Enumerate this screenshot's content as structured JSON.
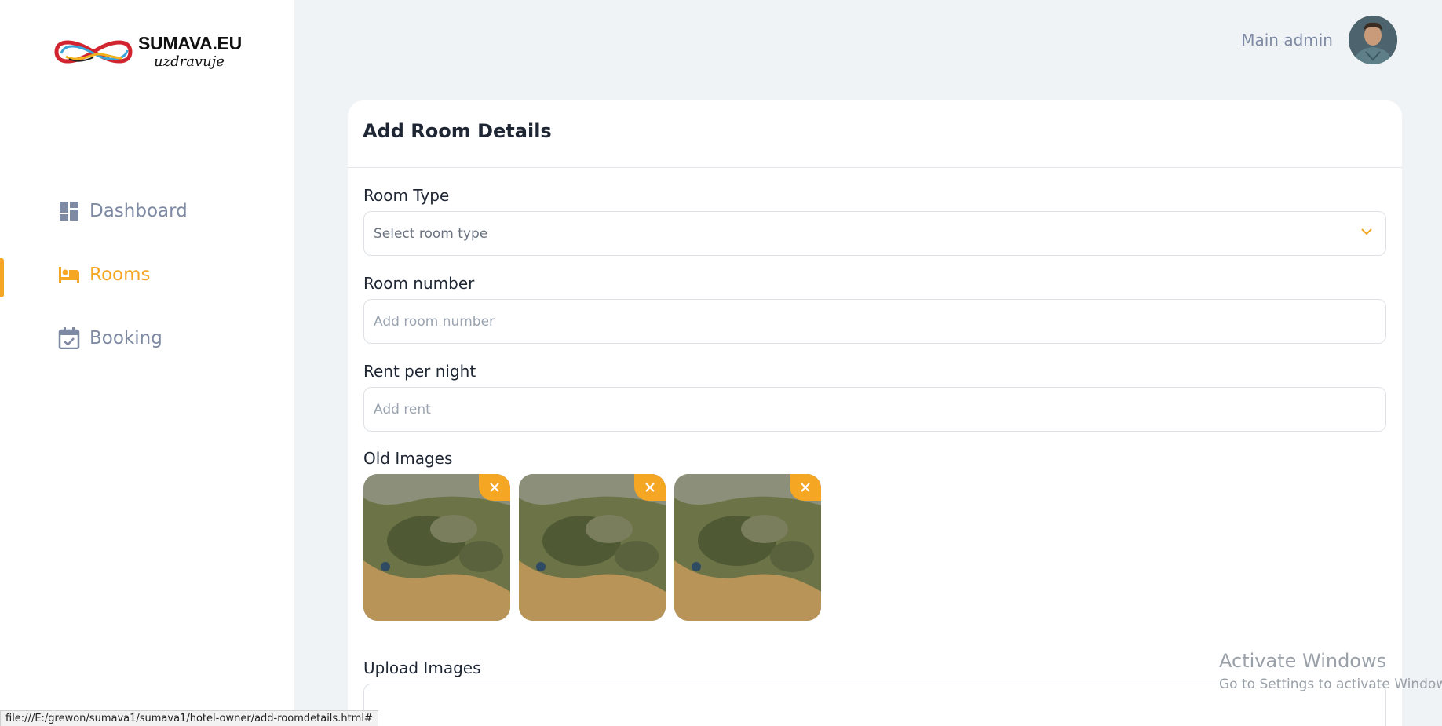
{
  "brand": {
    "name": "SUMAVA.EU",
    "tagline": "uzdravuje"
  },
  "sidebar": {
    "items": [
      {
        "label": "Dashboard",
        "icon": "dashboard-icon",
        "active": false
      },
      {
        "label": "Rooms",
        "icon": "bed-icon",
        "active": true
      },
      {
        "label": "Booking",
        "icon": "calendar-check-icon",
        "active": false
      }
    ]
  },
  "header": {
    "user_name": "Main admin"
  },
  "form": {
    "title": "Add Room Details",
    "room_type": {
      "label": "Room Type",
      "placeholder": "Select room type"
    },
    "room_number": {
      "label": "Room number",
      "placeholder": "Add room number"
    },
    "rent": {
      "label": "Rent per night",
      "placeholder": "Add rent"
    },
    "old_images": {
      "label": "Old Images",
      "count": 3
    },
    "upload": {
      "label": "Upload Images"
    }
  },
  "watermark": {
    "title": "Activate Windows",
    "subtitle": "Go to Settings to activate Windows."
  },
  "statusbar": {
    "url": "file:///E:/grewon/sumava1/sumava1/hotel-owner/add-roomdetails.html#"
  },
  "colors": {
    "accent": "#f5a623",
    "nav_inactive": "#7e8aa3",
    "background": "#f0f3f6"
  }
}
